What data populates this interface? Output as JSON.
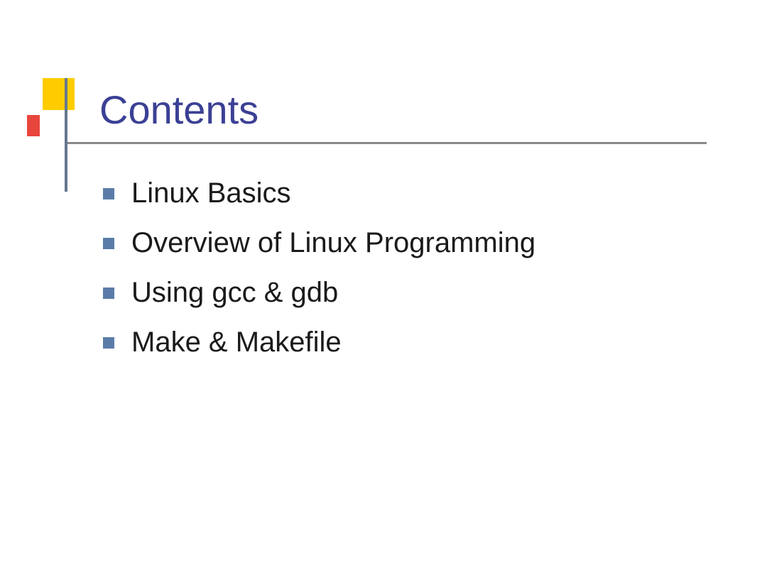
{
  "title": "Contents",
  "items": [
    "Linux Basics",
    "Overview of Linux Programming",
    "Using gcc & gdb",
    "Make & Makefile"
  ]
}
